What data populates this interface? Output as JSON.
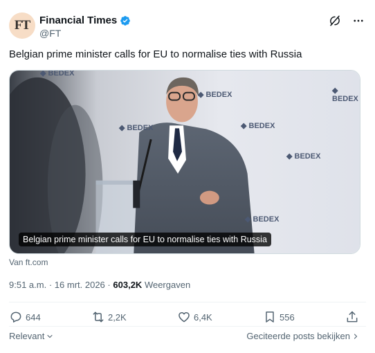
{
  "author": {
    "avatar_text": "FT",
    "name": "Financial Times",
    "handle": "@FT"
  },
  "tweet": {
    "text": "Belgian prime minister calls for EU to normalise ties with Russia",
    "media_caption": "Belgian prime minister calls for EU to normalise ties with Russia",
    "backdrop_logo": "BEDEX",
    "source": "Van ft.com",
    "time": "9:51 a.m.",
    "separator": "·",
    "date": "16 mrt. 2026",
    "views_count": "603,2K",
    "views_label": "Weergaven"
  },
  "actions": {
    "replies": "644",
    "reposts": "2,2K",
    "likes": "6,4K",
    "bookmarks": "556"
  },
  "footer": {
    "sort_label": "Relevant",
    "quotes_link": "Geciteerde posts bekijken"
  },
  "colors": {
    "verified": "#1d9bf0",
    "ft_avatar": "#f7ddc6",
    "muted_text": "#536471"
  },
  "icons": [
    "verified-badge-icon",
    "grok-icon",
    "more-icon",
    "reply-icon",
    "repost-icon",
    "like-icon",
    "bookmark-icon",
    "share-icon",
    "chevron-down-icon",
    "chevron-right-icon"
  ]
}
